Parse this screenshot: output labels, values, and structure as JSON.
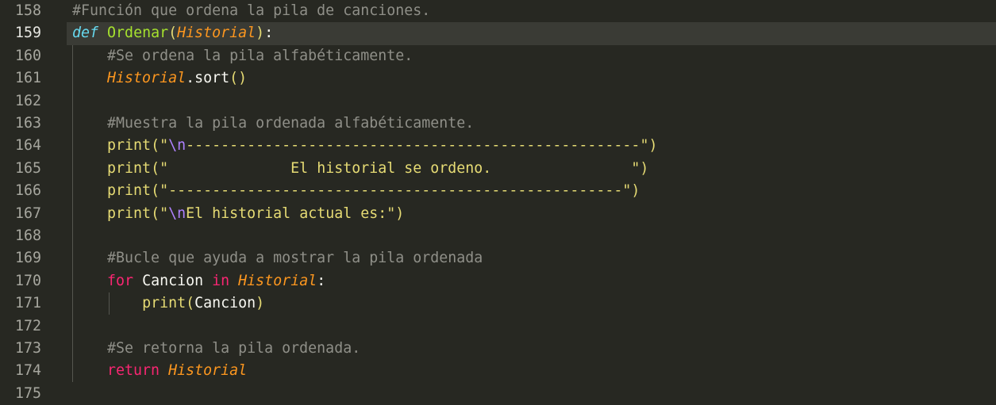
{
  "editor": {
    "active_line": "159",
    "line_numbers": [
      "158",
      "159",
      "160",
      "161",
      "162",
      "163",
      "164",
      "165",
      "166",
      "167",
      "168",
      "169",
      "170",
      "171",
      "172",
      "173",
      "174",
      "175"
    ],
    "code": {
      "l158": {
        "comment": "#Función que ordena la pila de canciones."
      },
      "l159": {
        "kw": "def",
        "fn": "Ordenar",
        "open": "(",
        "param": "Historial",
        "close": ")",
        "colon": ":"
      },
      "l160": {
        "comment": "#Se ordena la pila alfabéticamente."
      },
      "l161": {
        "obj": "Historial",
        "dot": ".",
        "method": "sort",
        "parens": "()"
      },
      "l163": {
        "comment": "#Muestra la pila ordenada alfabéticamente."
      },
      "l164": {
        "fn": "print",
        "open": "(",
        "q1": "\"",
        "esc": "\\n",
        "text": "----------------------------------------------------",
        "q2": "\"",
        "close": ")"
      },
      "l165": {
        "fn": "print",
        "open": "(",
        "text": "\"              El historial se ordeno.                \"",
        "close": ")"
      },
      "l166": {
        "fn": "print",
        "open": "(",
        "text": "\"----------------------------------------------------\"",
        "close": ")"
      },
      "l167": {
        "fn": "print",
        "open": "(",
        "q1": "\"",
        "esc": "\\n",
        "text": "El historial actual es:",
        "q2": "\"",
        "close": ")"
      },
      "l169": {
        "comment": "#Bucle que ayuda a mostrar la pila ordenada"
      },
      "l170": {
        "kw_for": "for",
        "var": "Cancion",
        "kw_in": "in",
        "iter": "Historial",
        "colon": ":"
      },
      "l171": {
        "fn": "print",
        "open": "(",
        "arg": "Cancion",
        "close": ")"
      },
      "l173": {
        "comment": "#Se retorna la pila ordenada."
      },
      "l174": {
        "kw": "return",
        "value": "Historial"
      }
    }
  },
  "colors": {
    "background": "#272822",
    "active_line_bg": "#3a3b35",
    "comment": "#8f8f88",
    "keyword_def": "#66d9ef",
    "keyword_control": "#f92672",
    "function": "#a6e22e",
    "parameter": "#fd971f",
    "string": "#e6db74",
    "escape": "#ae81ff",
    "plain": "#f8f8f2",
    "line_number": "#a6a69e"
  }
}
